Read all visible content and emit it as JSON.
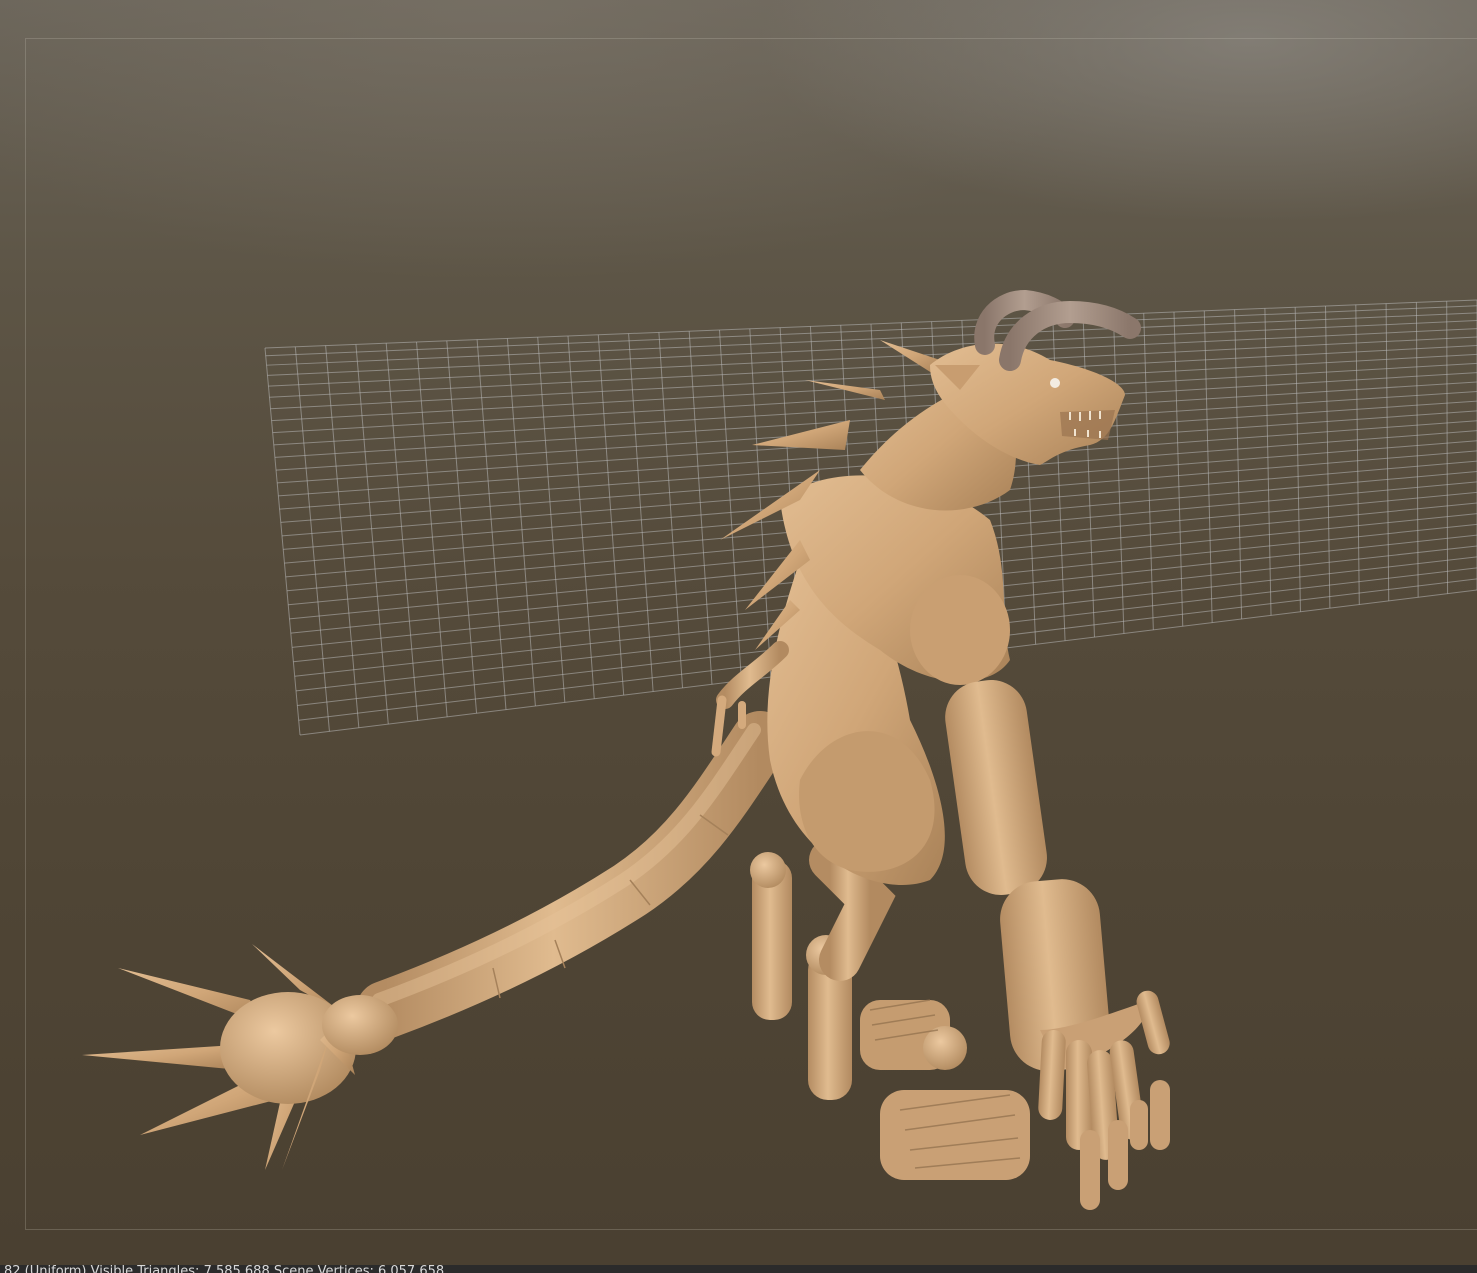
{
  "viewport": {
    "background_top": "#6b655a",
    "background_bottom": "#4a4031",
    "grid_color": "#b8b8b8",
    "model_color": "#d2a97c",
    "horn_color": "#9a8779"
  },
  "status_bar": {
    "text": "82 (Uniform)  Visible Triangles: 7,585,688  Scene Vertices: 6,057,658"
  }
}
